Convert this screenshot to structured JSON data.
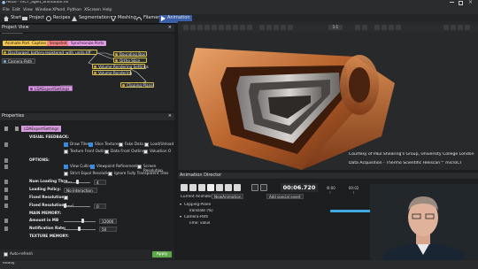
{
  "window": {
    "title": "Avizo - mCT_aged_animation.hx",
    "title_left_prefix": "●"
  },
  "menu": [
    "File",
    "Edit",
    "View",
    "Window",
    "XPand",
    "Python",
    "XScreen",
    "Help"
  ],
  "tabs": [
    {
      "label": "Start",
      "active": false
    },
    {
      "label": "Project",
      "active": false
    },
    {
      "label": "Recipes",
      "active": false
    },
    {
      "label": "Segmentation",
      "active": false
    },
    {
      "label": "Meshing",
      "active": false
    },
    {
      "label": "Filament",
      "active": false
    },
    {
      "label": "Animation",
      "active": true
    }
  ],
  "project_view": {
    "title": "Project View",
    "filter_placeholder": "Object Pool",
    "chips": [
      {
        "label": "Animate Ports",
        "color": "#f1c550"
      },
      {
        "label": "Caption",
        "color": "#f1c550"
      },
      {
        "label": "Snapshot",
        "color": "#f28080"
      },
      {
        "label": "Synchronize Ports",
        "color": "#e39be4"
      }
    ],
    "nodes": [
      {
        "label": "Discharged_battery.registered_with_units.tiff",
        "highlight": true
      },
      {
        "label": "Camera-Path",
        "highlight": false
      },
      {
        "label": "Bounding Box",
        "highlight": true
      },
      {
        "label": "Ortho Slice",
        "highlight": true
      },
      {
        "label": "Volume Rendering Settings",
        "highlight": true
      },
      {
        "label": "Volume Rendering",
        "highlight": true
      },
      {
        "label": "Clipping Plane",
        "highlight": true
      },
      {
        "label": "LDAExpertSettings",
        "highlight": false
      }
    ]
  },
  "properties": {
    "title": "Properties",
    "selected_tag": "LDAExpertSettings",
    "visual_feedback_label": "VISUAL FEEDBACK:",
    "options_label": "OPTIONS:",
    "visual_feedback_checks": [
      {
        "label": "Draw Tiles",
        "checked": true
      },
      {
        "label": "Slice Textures",
        "checked": true
      },
      {
        "label": "Fake Data",
        "checked": false
      },
      {
        "label": "Load/Unload",
        "checked": false
      },
      {
        "label": "Texture Front Outline",
        "checked": false
      },
      {
        "label": "Data Front Outline",
        "checked": false
      },
      {
        "label": "Valuation O",
        "checked": false
      }
    ],
    "options_checks": [
      {
        "label": "View Culling",
        "checked": true
      },
      {
        "label": "Viewpoint Refinement",
        "checked": true
      },
      {
        "label": "Screen Resolution",
        "checked": false
      },
      {
        "label": "Strict Equal Resolution",
        "checked": false
      },
      {
        "label": "Ignore Fully Transparent Tiles",
        "checked": false
      }
    ],
    "rows": [
      {
        "label": "Num Loading Thre...",
        "value": "4"
      },
      {
        "label": "Loading Policy:",
        "value": "No Interaction"
      },
      {
        "label": "Fixed Resolution:",
        "value": ""
      },
      {
        "label": "Fixed Resolution L...:",
        "value": "0"
      }
    ],
    "main_memory_label": "MAIN MEMORY:",
    "amount_label": "Amount in MB",
    "amount_value": "12000",
    "notification_label": "Notification Rate:",
    "notification_value": "50",
    "texture_memory_label": "TEXTURE MEMORY:",
    "auto_refresh_label": "Auto-refresh",
    "apply_label": "Apply"
  },
  "viewport": {
    "toolbar_zoom": "1:1",
    "caption_line1": "Courtesy of Paul Shearing's Group, University College London",
    "caption_line2": "Data Acquisition - Thermo Scientific Heliscan™ microCT"
  },
  "animation_director": {
    "title": "Animation Director",
    "time_value": "00:06.720",
    "current_animation_label": "Current Animation:",
    "current_animation_value": "NewAnimation",
    "add_special_event_label": "Add special event",
    "time_ticks": [
      "00:00",
      "00:02",
      "00:04",
      "00:06",
      "00:08",
      "00:10",
      "00:12"
    ],
    "playhead_fraction": 0.56,
    "tracks": [
      {
        "label": "Clipping-Plane",
        "indent": 0,
        "has_bar": false
      },
      {
        "label": "Translate (%)",
        "indent": 1,
        "has_bar": true,
        "bar_start": 0.0,
        "bar_end": 1.0
      },
      {
        "label": "Camera-Path",
        "indent": 0,
        "has_bar": false
      },
      {
        "label": "Time: value",
        "indent": 1,
        "has_bar": true,
        "bar_start": 0.55,
        "bar_end": 1.0
      }
    ]
  },
  "status": {
    "text": "Ready"
  },
  "colors": {
    "accent": "#3a5fa8",
    "track_bar": "#3fa9e0",
    "playhead": "#e07a2a",
    "apply": "#5fa84a"
  }
}
